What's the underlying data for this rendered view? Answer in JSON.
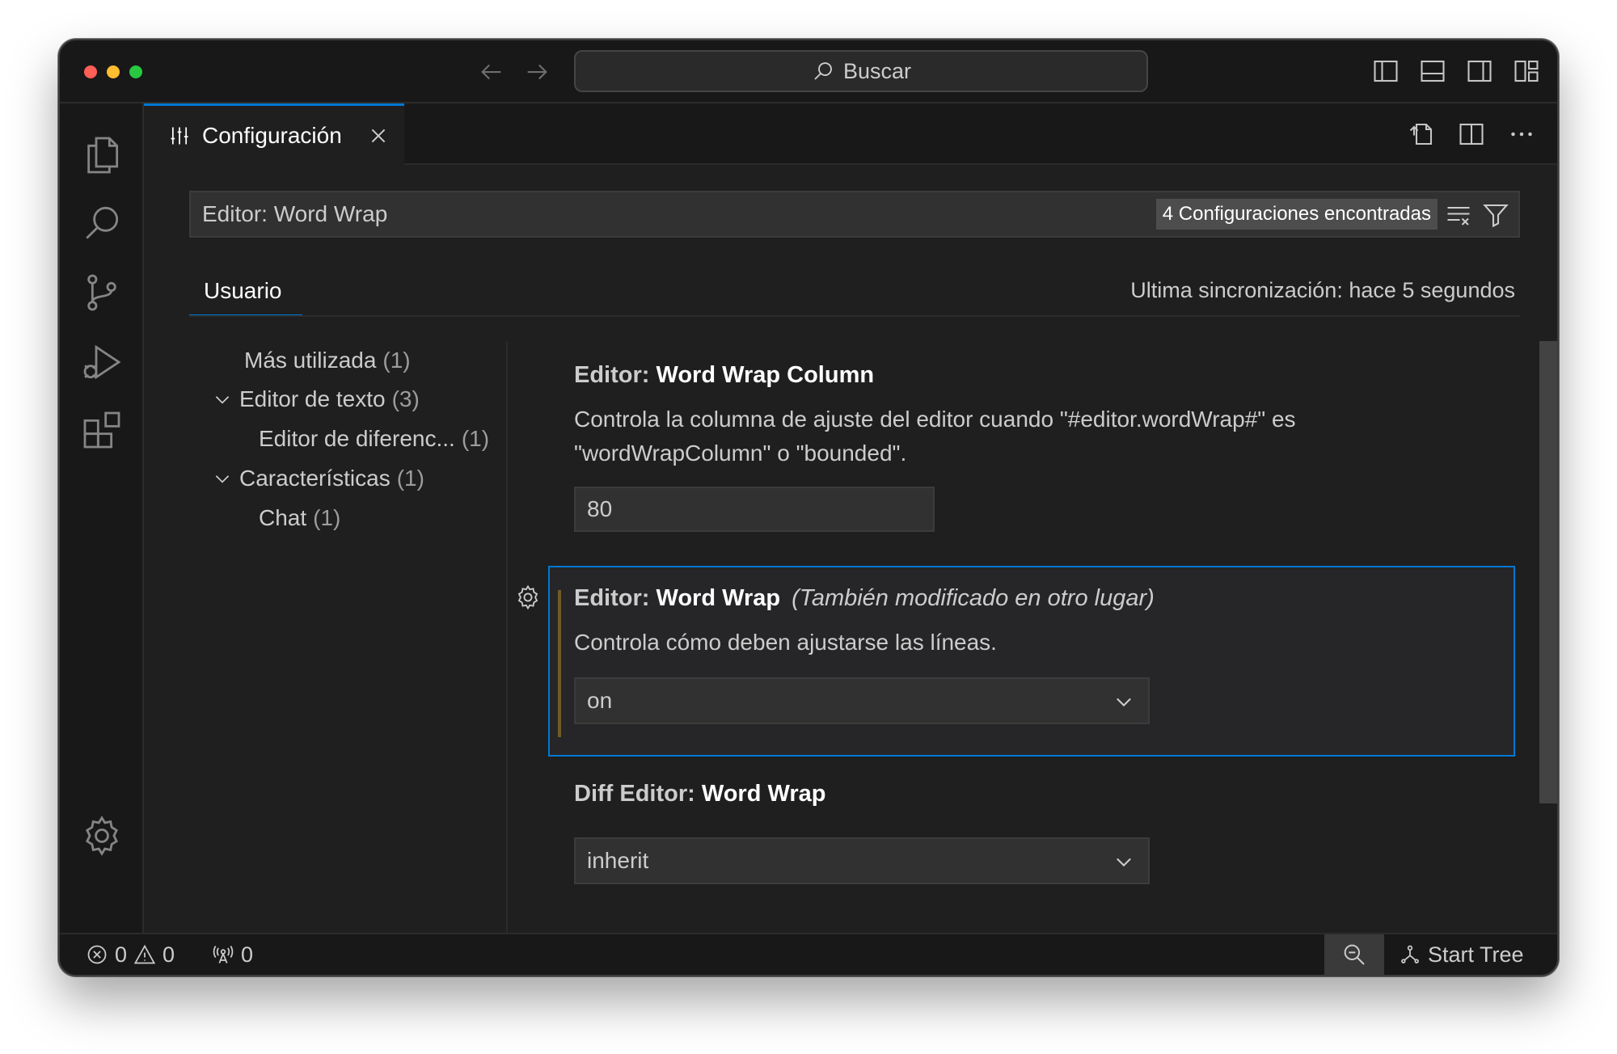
{
  "titlebar": {
    "search_label": "Buscar"
  },
  "tab": {
    "label": "Configuración"
  },
  "search": {
    "value": "Editor: Word Wrap",
    "results_badge": "4 Configuraciones encontradas"
  },
  "scope": {
    "tab_label": "Usuario",
    "sync_status": "Ultima sincronización: hace 5 segundos"
  },
  "toc": {
    "items": [
      {
        "label": "Más utilizada",
        "count": "(1)"
      },
      {
        "label": "Editor de texto",
        "count": "(3)"
      },
      {
        "label": "Editor de diferenc...",
        "count": "(1)"
      },
      {
        "label": "Características",
        "count": "(1)"
      },
      {
        "label": "Chat",
        "count": "(1)"
      }
    ]
  },
  "settings": [
    {
      "category": "Editor: ",
      "name": "Word Wrap Column",
      "description": "Controla la columna de ajuste del editor cuando \"#editor.wordWrap#\" es \"wordWrapColumn\" o \"bounded\".",
      "value": "80"
    },
    {
      "category": "Editor: ",
      "name": "Word Wrap",
      "modified_note": "(También modificado en otro lugar)",
      "description": "Controla cómo deben ajustarse las líneas.",
      "value": "on"
    },
    {
      "category": "Diff Editor: ",
      "name": "Word Wrap",
      "value": "inherit"
    }
  ],
  "statusbar": {
    "errors": "0",
    "warnings": "0",
    "ports": "0",
    "start_tree": "Start Tree"
  },
  "colors": {
    "accent": "#0078d4",
    "background": "#1f1f1f",
    "sidebar": "#181818"
  }
}
